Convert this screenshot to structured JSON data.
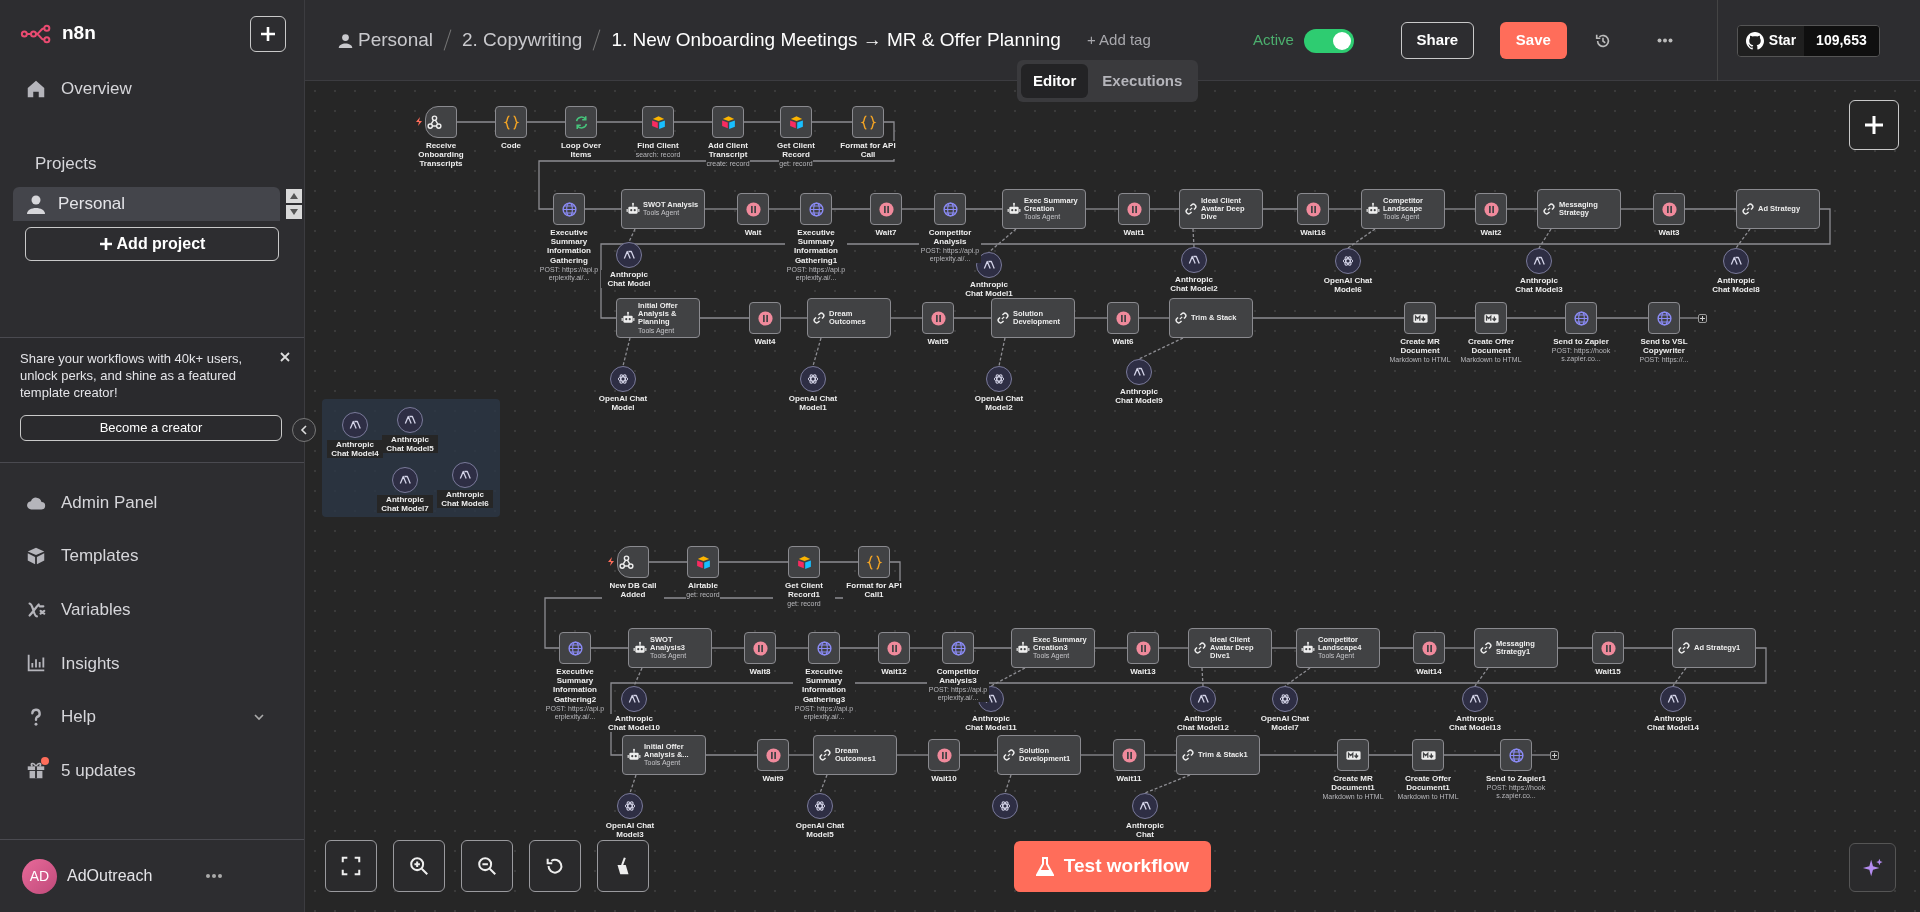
{
  "sidebar": {
    "brand": "n8n",
    "items_top": [
      {
        "label": "Overview"
      }
    ],
    "projects_title": "Projects",
    "projects": [
      {
        "label": "Personal",
        "selected": true
      }
    ],
    "add_project": "Add project",
    "promo": {
      "text": "Share your workflows with 40k+ users, unlock perks, and shine as a featured template creator!",
      "button": "Become a creator"
    },
    "items_bottom": [
      {
        "label": "Admin Panel",
        "expandable": false,
        "badge": false
      },
      {
        "label": "Templates",
        "expandable": false,
        "badge": false
      },
      {
        "label": "Variables",
        "expandable": false,
        "badge": false
      },
      {
        "label": "Insights",
        "expandable": false,
        "badge": false
      },
      {
        "label": "Help",
        "expandable": true,
        "badge": false
      },
      {
        "label": "5 updates",
        "expandable": false,
        "badge": true
      }
    ],
    "user": {
      "initials": "AD",
      "name": "AdOutreach"
    }
  },
  "header": {
    "breadcrumbs": [
      "Personal",
      "2. Copywriting",
      "1. New Onboarding Meetings → MR & Offer Planning"
    ],
    "add_tag": "+ Add tag",
    "active_label": "Active",
    "active": true,
    "share": "Share",
    "save": "Save",
    "github": {
      "star": "Star",
      "count": "109,653"
    },
    "tabs": [
      {
        "label": "Editor",
        "selected": true
      },
      {
        "label": "Executions",
        "selected": false
      }
    ]
  },
  "canvas": {
    "workflows": [
      {
        "rows": [
          {
            "nodes": [
              {
                "kind": "trigger",
                "name": "Receive Onboarding Transcripts"
              },
              {
                "kind": "code",
                "name": "Code"
              },
              {
                "kind": "loop",
                "name": "Loop Over Items"
              },
              {
                "kind": "airtable",
                "name": "Find Client",
                "subtitle": "search: record"
              },
              {
                "kind": "airtable",
                "name": "Add Client Transcript",
                "subtitle": "create: record"
              },
              {
                "kind": "airtable",
                "name": "Get Client Record",
                "subtitle": "get: record"
              },
              {
                "kind": "code",
                "name": "Format for API Call"
              }
            ]
          },
          {
            "nodes": [
              {
                "kind": "http",
                "name": "Executive Summary Information Gathering",
                "subtitle": "POST: https://api.perplexity.ai/..."
              },
              {
                "kind": "agent",
                "name": "SWOT Analysis",
                "subtitle": "Tools Agent",
                "model": {
                  "kind": "anthropic",
                  "name": "Anthropic Chat Model"
                }
              },
              {
                "kind": "wait",
                "name": "Wait"
              },
              {
                "kind": "http",
                "name": "Executive Summary Information Gathering1",
                "subtitle": "POST: https://api.perplexity.ai/..."
              },
              {
                "kind": "wait",
                "name": "Wait7"
              },
              {
                "kind": "http",
                "name": "Competitor Analysis",
                "subtitle": "POST: https://api.perplexity.ai/..."
              },
              {
                "kind": "agent",
                "name": "Exec Summary Creation",
                "subtitle": "Tools Agent",
                "model": {
                  "kind": "anthropic",
                  "name": "Anthropic Chat Model1"
                }
              },
              {
                "kind": "wait",
                "name": "Wait1"
              },
              {
                "kind": "chain",
                "name": "Ideal Client Avatar Deep Dive",
                "model": {
                  "kind": "anthropic",
                  "name": "Anthropic Chat Model2"
                }
              },
              {
                "kind": "wait",
                "name": "Wait16"
              },
              {
                "kind": "agent",
                "name": "Competitor Landscape",
                "subtitle": "Tools Agent",
                "model": {
                  "kind": "openai",
                  "name": "OpenAI Chat Model6"
                }
              },
              {
                "kind": "wait",
                "name": "Wait2"
              },
              {
                "kind": "chain",
                "name": "Messaging Strategy",
                "model": {
                  "kind": "anthropic",
                  "name": "Anthropic Chat Model3"
                }
              },
              {
                "kind": "wait",
                "name": "Wait3"
              },
              {
                "kind": "chain",
                "name": "Ad Strategy",
                "model": {
                  "kind": "anthropic",
                  "name": "Anthropic Chat Model8"
                }
              }
            ]
          },
          {
            "nodes": [
              {
                "kind": "agent",
                "name": "Initial Offer Analysis & Planning",
                "subtitle": "Tools Agent",
                "model": {
                  "kind": "openai",
                  "name": "OpenAI Chat Model"
                }
              },
              {
                "kind": "wait",
                "name": "Wait4"
              },
              {
                "kind": "chain",
                "name": "Dream Outcomes",
                "model": {
                  "kind": "openai",
                  "name": "OpenAI Chat Model1"
                }
              },
              {
                "kind": "wait",
                "name": "Wait5"
              },
              {
                "kind": "chain",
                "name": "Solution Development",
                "model": {
                  "kind": "openai",
                  "name": "OpenAI Chat Model2"
                }
              },
              {
                "kind": "wait",
                "name": "Wait6"
              },
              {
                "kind": "chain",
                "name": "Trim & Stack",
                "model": {
                  "kind": "anthropic",
                  "name": "Anthropic Chat Model9"
                }
              },
              {
                "kind": "markdown",
                "name": "Create MR Document",
                "subtitle": "Markdown to HTML"
              },
              {
                "kind": "markdown",
                "name": "Create Offer Document",
                "subtitle": "Markdown to HTML"
              },
              {
                "kind": "http",
                "name": "Send to Zapier",
                "subtitle": "POST: https://hooks.zapier.co..."
              },
              {
                "kind": "http",
                "name": "Send to VSL Copywriter",
                "subtitle": "POST: https://..."
              }
            ]
          }
        ]
      },
      {
        "rows": [
          {
            "nodes": [
              {
                "kind": "trigger",
                "name": "New DB Call Added"
              },
              {
                "kind": "airtable",
                "name": "Airtable",
                "subtitle": "get: record"
              },
              {
                "kind": "airtable",
                "name": "Get Client Record1",
                "subtitle": "get: record"
              },
              {
                "kind": "code",
                "name": "Format for API Call1"
              }
            ]
          },
          {
            "nodes": [
              {
                "kind": "http",
                "name": "Executive Summary Information Gathering2",
                "subtitle": "POST: https://api.perplexity.ai/..."
              },
              {
                "kind": "agent",
                "name": "SWOT Analysis3",
                "subtitle": "Tools Agent",
                "model": {
                  "kind": "anthropic",
                  "name": "Anthropic Chat Model10"
                }
              },
              {
                "kind": "wait",
                "name": "Wait8"
              },
              {
                "kind": "http",
                "name": "Executive Summary Information Gathering3",
                "subtitle": "POST: https://api.perplexity.ai/..."
              },
              {
                "kind": "wait",
                "name": "Wait12"
              },
              {
                "kind": "http",
                "name": "Competitor Analysis3",
                "subtitle": "POST: https://api.perplexity.ai/..."
              },
              {
                "kind": "agent",
                "name": "Exec Summary Creation3",
                "subtitle": "Tools Agent",
                "model": {
                  "kind": "anthropic",
                  "name": "Anthropic Chat Model11"
                }
              },
              {
                "kind": "wait",
                "name": "Wait13"
              },
              {
                "kind": "chain",
                "name": "Ideal Client Avatar Deep Dive1",
                "model": {
                  "kind": "anthropic",
                  "name": "Anthropic Chat Model12"
                }
              },
              {
                "kind": "agent",
                "name": "Competitor Landscape4",
                "subtitle": "Tools Agent",
                "model": {
                  "kind": "openai",
                  "name": "OpenAI Chat Model7"
                }
              },
              {
                "kind": "wait",
                "name": "Wait14"
              },
              {
                "kind": "chain",
                "name": "Messaging Strategy1",
                "model": {
                  "kind": "anthropic",
                  "name": "Anthropic Chat Model13"
                }
              },
              {
                "kind": "wait",
                "name": "Wait15"
              },
              {
                "kind": "chain",
                "name": "Ad Strategy1",
                "model": {
                  "kind": "anthropic",
                  "name": "Anthropic Chat Model14"
                }
              }
            ]
          },
          {
            "nodes": [
              {
                "kind": "agent",
                "name": "Initial Offer Analysis &...",
                "subtitle": "Tools Agent",
                "model": {
                  "kind": "openai",
                  "name": "OpenAI Chat Model3"
                }
              },
              {
                "kind": "wait",
                "name": "Wait9"
              },
              {
                "kind": "chain",
                "name": "Dream Outcomes1",
                "model": {
                  "kind": "openai",
                  "name": "OpenAI Chat Model5"
                }
              },
              {
                "kind": "wait",
                "name": "Wait10"
              },
              {
                "kind": "chain",
                "name": "Solution Development1",
                "model": {
                  "kind": "openai"
                }
              },
              {
                "kind": "wait",
                "name": "Wait11"
              },
              {
                "kind": "chain",
                "name": "Trim & Stack1",
                "model": {
                  "kind": "anthropic",
                  "name": "Anthropic Chat"
                }
              },
              {
                "kind": "markdown",
                "name": "Create MR Document1",
                "subtitle": "Markdown to HTML"
              },
              {
                "kind": "markdown",
                "name": "Create Offer Document1",
                "subtitle": "Markdown to HTML"
              },
              {
                "kind": "http",
                "name": "Send to Zapier1",
                "subtitle": "POST: https://hooks.zapier.co..."
              }
            ]
          }
        ]
      }
    ],
    "loose_models": [
      {
        "kind": "anthropic",
        "name": "Anthropic Chat Model4"
      },
      {
        "kind": "anthropic",
        "name": "Anthropic Chat Model5"
      },
      {
        "kind": "anthropic",
        "name": "Anthropic Chat Model7"
      },
      {
        "kind": "anthropic",
        "name": "Anthropic Chat Model6"
      }
    ],
    "test_button": "Test workflow"
  }
}
